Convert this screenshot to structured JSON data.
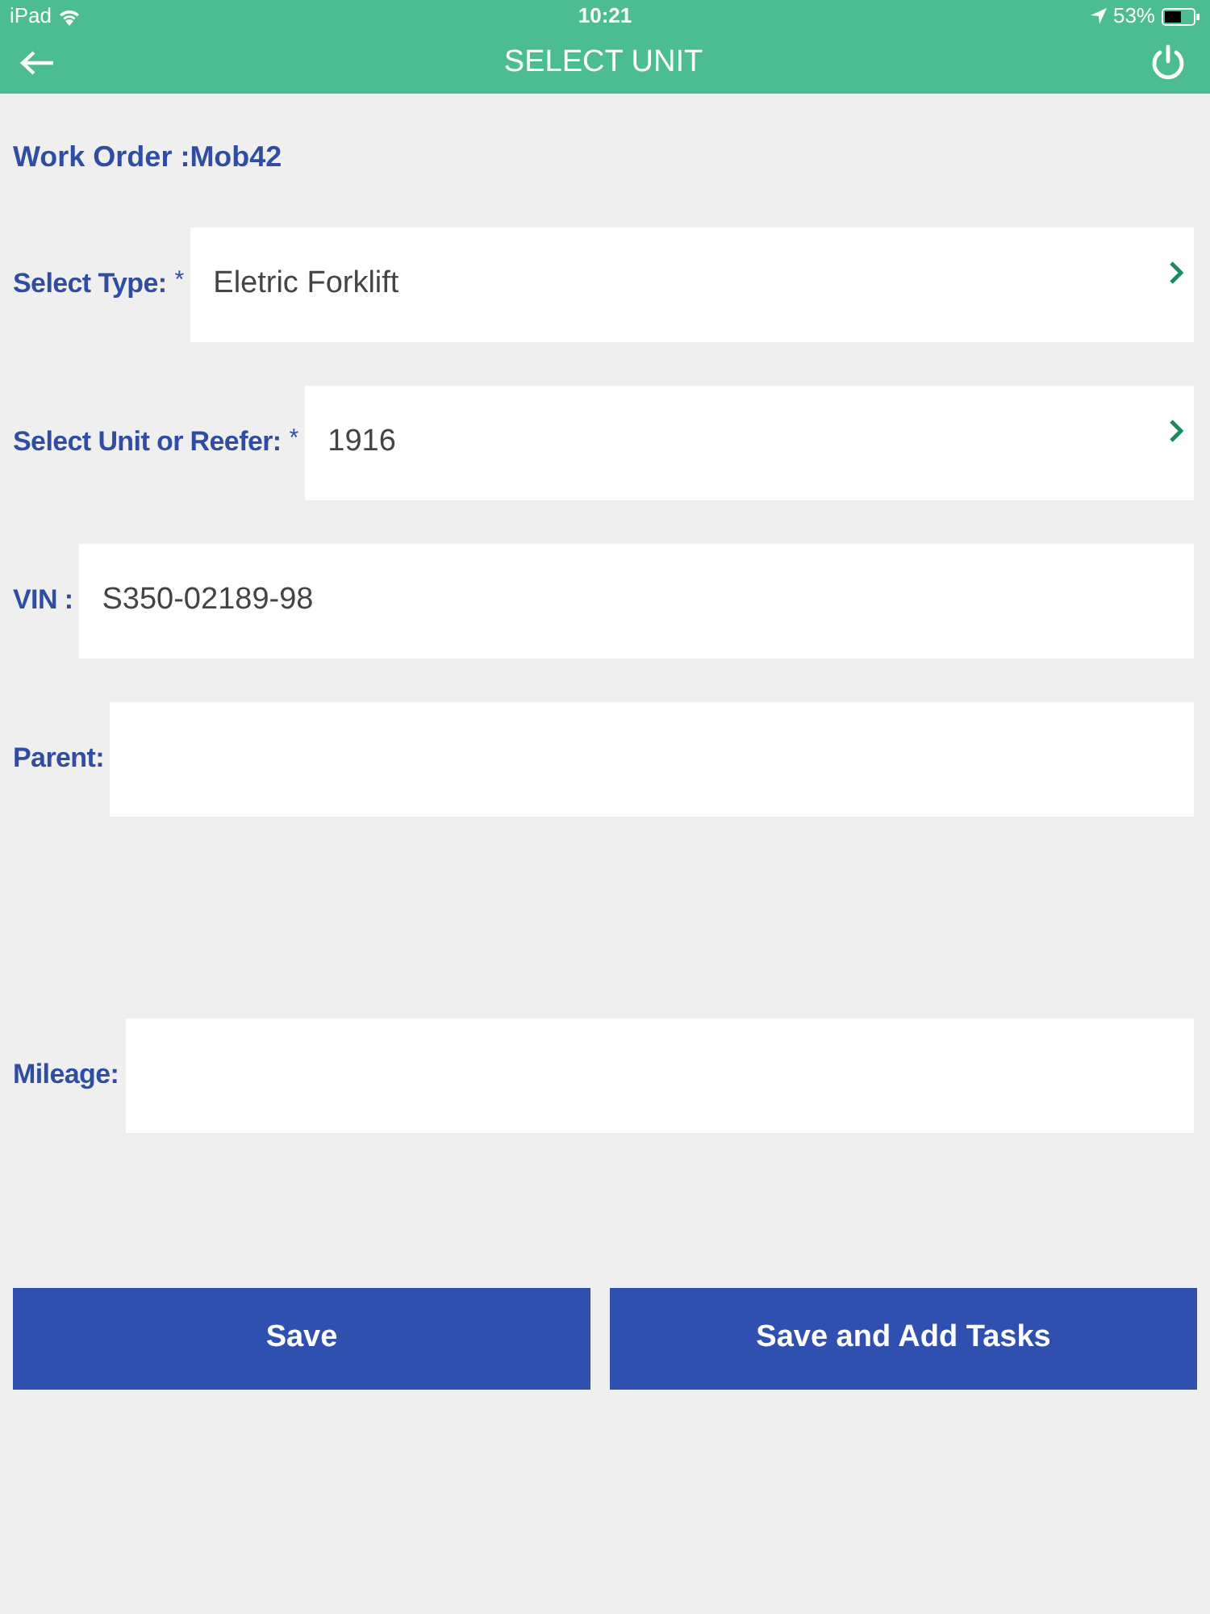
{
  "status_bar": {
    "device": "iPad",
    "time": "10:21",
    "battery": "53%"
  },
  "nav_bar": {
    "title": "SELECT UNIT"
  },
  "work_order": {
    "label": "Work Order :",
    "value": "Mob42"
  },
  "fields": [
    {
      "kind": "select",
      "label": "Select Type:",
      "required_mark": "*",
      "value": "Eletric Forklift"
    },
    {
      "kind": "select",
      "label": "Select Unit or Reefer:",
      "required_mark": "*",
      "value": "1916"
    },
    {
      "kind": "text",
      "label": "VIN :",
      "value": "S350-02189-98"
    },
    {
      "kind": "text",
      "label": "Parent:"
    },
    {
      "kind": "text",
      "label": "Mileage:"
    }
  ],
  "buttons": [
    "Save",
    "Save and Add Tasks"
  ]
}
